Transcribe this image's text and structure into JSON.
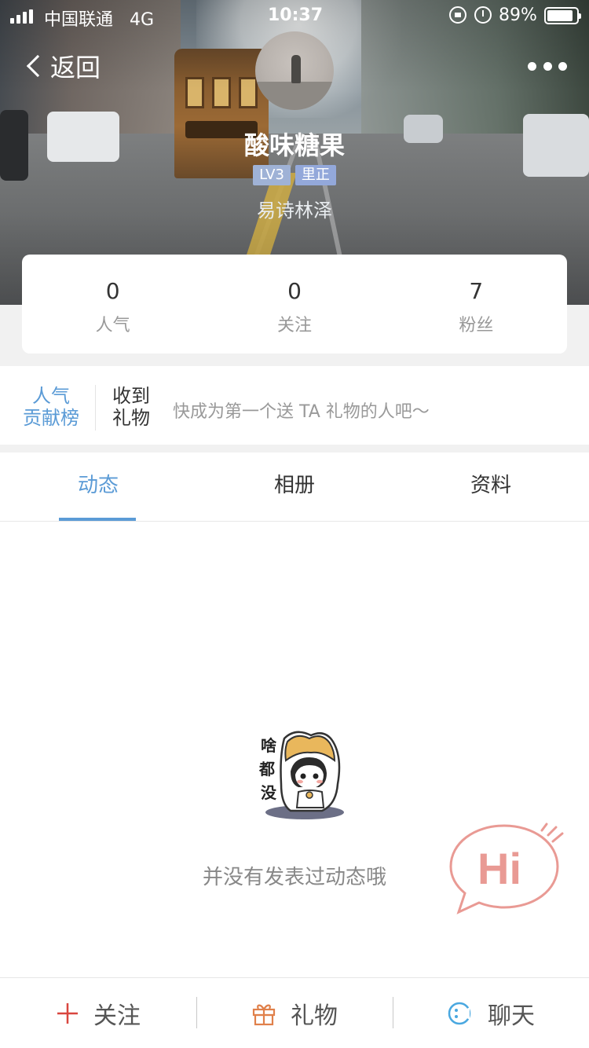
{
  "status_bar": {
    "carrier": "中国联通",
    "network": "4G",
    "time": "10:37",
    "battery": "89%"
  },
  "nav": {
    "back_label": "返回"
  },
  "profile": {
    "nickname": "酸味糖果",
    "level": "LV3",
    "rank": "里正",
    "subname": "易诗林泽"
  },
  "stats": [
    {
      "value": "0",
      "label": "人气"
    },
    {
      "value": "0",
      "label": "关注"
    },
    {
      "value": "7",
      "label": "粉丝"
    }
  ],
  "gift": {
    "rank_link_line1": "人气",
    "rank_link_line2": "贡献榜",
    "received_line1": "收到",
    "received_line2": "礼物",
    "hint": "快成为第一个送 TA 礼物的人吧～"
  },
  "tabs": [
    {
      "label": "动态",
      "active": true
    },
    {
      "label": "相册",
      "active": false
    },
    {
      "label": "资料",
      "active": false
    }
  ],
  "empty": {
    "sticker_text": [
      "啥",
      "都",
      "没"
    ],
    "message": "并没有发表过动态哦"
  },
  "hi_bubble": {
    "text": "Hi"
  },
  "bottom_bar": {
    "follow": "关注",
    "gift": "礼物",
    "chat": "聊天"
  },
  "colors": {
    "accent": "#5b9bd6",
    "follow_plus": "#d9463f",
    "gift_icon": "#e0804a",
    "hi_pink": "#e99a94"
  }
}
